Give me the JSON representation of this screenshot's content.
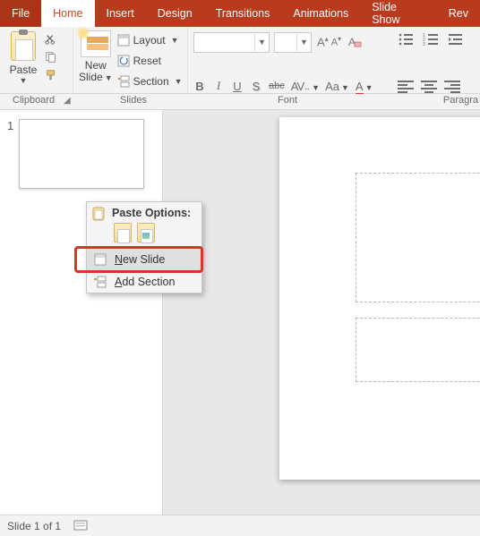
{
  "tabs": {
    "file": "File",
    "home": "Home",
    "insert": "Insert",
    "design": "Design",
    "transitions": "Transitions",
    "animations": "Animations",
    "slideshow": "Slide Show",
    "review": "Rev"
  },
  "ribbon": {
    "clipboard": {
      "paste": "Paste",
      "group_label": "Clipboard"
    },
    "slides": {
      "new_slide": "New",
      "new_slide2": "Slide",
      "layout": "Layout",
      "reset": "Reset",
      "section": "Section",
      "group_label": "Slides"
    },
    "font": {
      "name_value": "",
      "size_value": "",
      "bold": "B",
      "italic": "I",
      "underline": "U",
      "shadow": "S",
      "strike": "abc",
      "spacing": "AV",
      "changecase": "Aa",
      "fontcolor": "A",
      "group_label": "Font"
    },
    "paragraph": {
      "group_label": "Paragra"
    }
  },
  "thumb": {
    "n1": "1"
  },
  "context_menu": {
    "paste_options": "Paste Options:",
    "new_slide_pre": "N",
    "new_slide_rest": "ew Slide",
    "add_section_pre": "A",
    "add_section_rest": "dd Section"
  },
  "status": {
    "slide_of": "Slide 1 of 1"
  }
}
